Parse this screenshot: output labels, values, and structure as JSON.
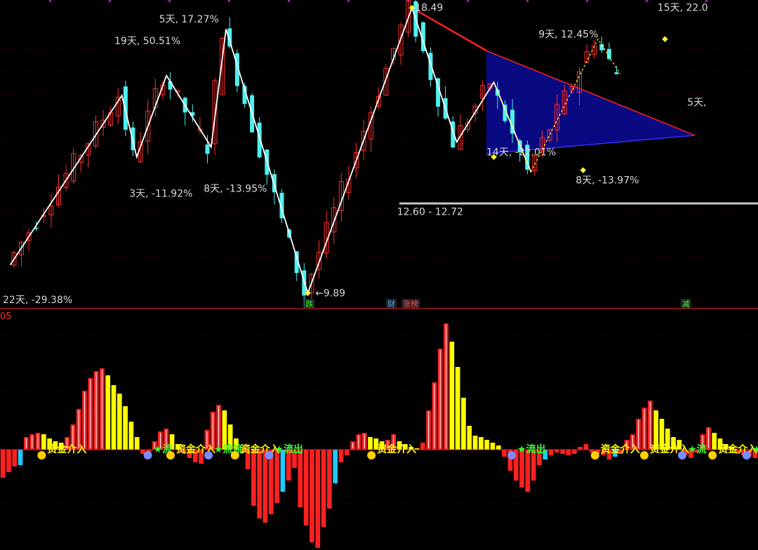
{
  "colors": {
    "up": "#ff3030",
    "down": "#4ef0f0",
    "zigzag": "#ffffff",
    "label": "#d8d8d8",
    "grid": "#5a0000",
    "divider": "#aa1a1a",
    "triangle": "#0a0a8c",
    "resistance": "#ff2020",
    "support_line": "#c8c8c8",
    "flow_in_up": "#ff2020",
    "flow_in_down": "#ffff00",
    "flow_out": "#ff2020",
    "flow_out_alt": "#22c8ff",
    "sig_in": "#ffff00",
    "sig_out": "#33ff33"
  },
  "chart_data": [
    {
      "type": "candlestick",
      "title": "",
      "zigzag": [
        {
          "x": 1,
          "price": 10.75
        },
        {
          "x": 16,
          "price": 15.85
        },
        {
          "x": 18,
          "price": 14.0
        },
        {
          "x": 22,
          "price": 16.45
        },
        {
          "x": 28,
          "price": 14.3
        },
        {
          "x": 30,
          "price": 17.85
        },
        {
          "x": 41,
          "price": 9.9
        },
        {
          "x": 55,
          "price": 18.49
        },
        {
          "x": 61,
          "price": 14.45
        },
        {
          "x": 66,
          "price": 16.25
        },
        {
          "x": 71,
          "price": 13.55
        },
        {
          "x": 80,
          "price": 17.55
        },
        {
          "x": 83,
          "price": 16.5
        }
      ],
      "level_labels": [
        {
          "text": "22天, -29.38%",
          "x": 0,
          "price": 9.6
        },
        {
          "text": "19天, 50.51%",
          "x": 15,
          "price": 17.4
        },
        {
          "text": "3天, -11.92%",
          "x": 17,
          "price": 12.8
        },
        {
          "text": "5天, 17.27%",
          "x": 21,
          "price": 18.05
        },
        {
          "text": "8天, -13.95%",
          "x": 27,
          "price": 12.95
        },
        {
          "text": "9天, 12.45%",
          "x": 72,
          "price": 17.6
        },
        {
          "text": "14天, -22.01%",
          "x": 65,
          "price": 14.05
        },
        {
          "text": "8天, -13.97%",
          "x": 77,
          "price": 13.2
        },
        {
          "text": "15天, 22.0",
          "x": 88,
          "price": 18.4
        },
        {
          "text": "5天,",
          "x": 92,
          "price": 15.55
        }
      ],
      "price_labels": [
        {
          "text": "18.49",
          "x": 55.4,
          "price": 18.4
        },
        {
          "text": "←9.89",
          "x": 42.0,
          "price": 9.8
        },
        {
          "text": "12.60 - 12.72",
          "x": 53.0,
          "price": 12.25
        }
      ],
      "event_markers": [
        {
          "text": "跌",
          "x": 40.6,
          "color": "#33ff33"
        },
        {
          "text": "财",
          "x": 51.6,
          "color": "#4aa8ff"
        },
        {
          "text": "涨榜",
          "x": 53.7,
          "color": "#ff5050"
        },
        {
          "text": "减",
          "x": 91.2,
          "color": "#33ff33"
        }
      ],
      "support_price": 12.6,
      "resistance": [
        {
          "x": 55,
          "price": 18.49
        },
        {
          "x": 65,
          "price": 17.2
        }
      ],
      "triangle": [
        {
          "x": 65,
          "price": 17.2
        },
        {
          "x": 93,
          "price": 14.65
        },
        {
          "x": 65,
          "price": 14.1
        },
        {
          "x": 78,
          "price": 13.6
        }
      ],
      "pivot_points": [
        {
          "x": 41,
          "price": 9.9
        },
        {
          "x": 55,
          "price": 18.49
        },
        {
          "x": 66,
          "price": 14.0
        },
        {
          "x": 78,
          "price": 13.6
        },
        {
          "x": 89,
          "price": 17.55
        }
      ]
    },
    {
      "type": "bar",
      "title": "05",
      "series": [
        {
          "values": [
            -40,
            -32,
            -24,
            -22,
            18,
            22,
            24,
            22,
            16,
            12,
            10,
            18,
            36,
            58,
            84,
            102,
            112,
            116,
            106,
            92,
            80,
            62,
            40,
            18,
            -6,
            -10,
            12,
            26,
            30,
            22,
            8,
            -6,
            -12,
            -18,
            -20,
            28,
            54,
            64,
            56,
            36,
            16,
            -4,
            -28,
            -80,
            -98,
            -104,
            -92,
            -76,
            -60,
            -44,
            -26,
            -82,
            -108,
            -132,
            -140,
            -110,
            -84,
            -48,
            -18,
            -8,
            12,
            22,
            24,
            18,
            16,
            12,
            14,
            22,
            12,
            8,
            4,
            2,
            10,
            56,
            96,
            144,
            180,
            154,
            118,
            74,
            34,
            20,
            18,
            14,
            10,
            6,
            -10,
            -30,
            -44,
            -54,
            -60,
            -44,
            -22,
            -14,
            -8,
            -4,
            -6,
            -8,
            -6,
            4,
            8,
            -4,
            -6,
            -8,
            -14,
            -10,
            -6,
            14,
            22,
            44,
            60,
            70,
            56,
            44,
            30,
            18,
            14,
            -8,
            -12,
            -4,
            22,
            32,
            24,
            16,
            8,
            4,
            -6,
            -8,
            -10,
            -12
          ]
        }
      ],
      "signals": [
        {
          "text": "资金介入",
          "x": 5.5,
          "kind": "in"
        },
        {
          "text": "流",
          "x": 19.5,
          "kind": "out"
        },
        {
          "text": "资金介入",
          "x": 22.5,
          "kind": "in"
        },
        {
          "text": "流流",
          "x": 27.5,
          "kind": "out"
        },
        {
          "text": "资金介入",
          "x": 31.0,
          "kind": "in"
        },
        {
          "text": "流出",
          "x": 35.5,
          "kind": "out"
        },
        {
          "text": "资金介入",
          "x": 49.0,
          "kind": "in"
        },
        {
          "text": "流出",
          "x": 67.5,
          "kind": "out"
        },
        {
          "text": "资金介入",
          "x": 78.5,
          "kind": "in"
        },
        {
          "text": "资金介入",
          "x": 85.0,
          "kind": "in"
        },
        {
          "text": "流",
          "x": 90.0,
          "kind": "out"
        },
        {
          "text": "资金介入",
          "x": 94.0,
          "kind": "in"
        },
        {
          "text": "流出",
          "x": 98.5,
          "kind": "out"
        }
      ]
    }
  ]
}
